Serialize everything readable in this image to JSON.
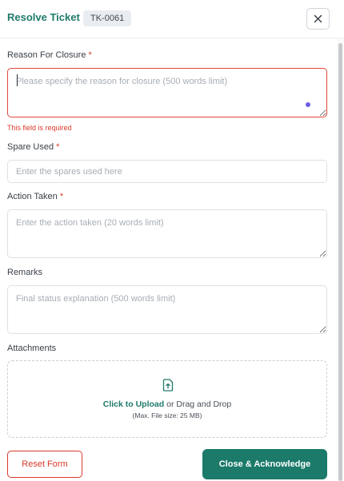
{
  "header": {
    "title": "Resolve Ticket",
    "ticket_id": "TK-0061"
  },
  "form": {
    "reason": {
      "label": "Reason For Closure",
      "required_mark": "*",
      "placeholder": "Please specify the reason for closure (500 words limit)",
      "value": "",
      "error": "This field is required"
    },
    "spare": {
      "label": "Spare Used",
      "required_mark": "*",
      "placeholder": "Enter the spares used here",
      "value": ""
    },
    "action": {
      "label": "Action Taken",
      "required_mark": "*",
      "placeholder": "Enter the action taken (20 words limit)",
      "value": ""
    },
    "remarks": {
      "label": "Remarks",
      "placeholder": "Final status explanation (500 words limit)",
      "value": ""
    },
    "attachments": {
      "label": "Attachments",
      "upload_link": "Click to Upload",
      "upload_rest": " or Drag and Drop",
      "hint": "(Max. File size: 25 MB)"
    }
  },
  "footer": {
    "reset_label": "Reset Form",
    "submit_label": "Close & Acknowledge"
  },
  "icons": {
    "close": "close-icon",
    "upload": "upload-icon",
    "resize": "resize-grip-icon"
  },
  "colors": {
    "accent": "#1f7a6b",
    "primary_button": "#1b7a6a",
    "error": "#d9392b",
    "badge_bg": "#e9edf1",
    "indicator_dot": "#6c5ce7"
  }
}
